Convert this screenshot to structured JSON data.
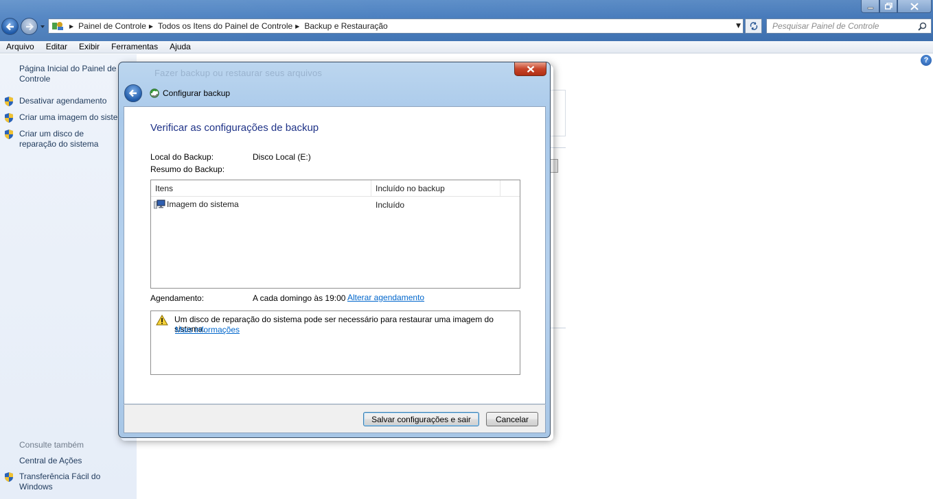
{
  "window": {
    "breadcrumbs": [
      "Painel de Controle",
      "Todos os Itens do Painel de Controle",
      "Backup e Restauração"
    ],
    "search_placeholder": "Pesquisar Painel de Controle"
  },
  "menu": [
    "Arquivo",
    "Editar",
    "Exibir",
    "Ferramentas",
    "Ajuda"
  ],
  "sidebar": {
    "home_link": "Página Inicial do Painel de Controle",
    "tasks": [
      "Desativar agendamento",
      "Criar uma imagem do sistema",
      "Criar um disco de reparação do sistema"
    ],
    "see_also_heading": "Consulte também",
    "see_also": [
      "Central de Ações",
      "Transferência Fácil do Windows"
    ]
  },
  "background": {
    "heading": "Fazer backup ou restaurar seus arquivos"
  },
  "dialog": {
    "title": "Configurar backup",
    "heading": "Verificar as configurações de backup",
    "backup_location_label": "Local do Backup:",
    "backup_location_value": "Disco Local (E:)",
    "backup_summary_label": "Resumo do Backup:",
    "table": {
      "columns": [
        "Itens",
        "Incluído no backup"
      ],
      "rows": [
        {
          "item": "Imagem do sistema",
          "included": "Incluído",
          "icon": "system-image-icon"
        }
      ]
    },
    "schedule_label": "Agendamento:",
    "schedule_value": "A cada domingo às 19:00",
    "schedule_link": "Alterar agendamento",
    "warning_text": "Um disco de reparação do sistema pode ser necessário para restaurar uma imagem do sistema.",
    "warning_link": "Mais informações",
    "save_button": "Salvar configurações e sair",
    "cancel_button": "Cancelar"
  },
  "colors": {
    "heading_blue": "#1e3287",
    "link_blue": "#0066cc",
    "sidebar_link": "#1e395b"
  }
}
